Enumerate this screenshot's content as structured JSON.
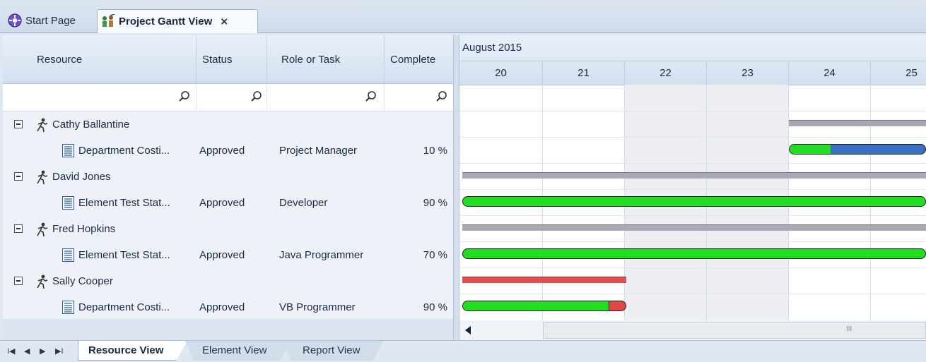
{
  "doc_tabs": {
    "start_label": "Start Page",
    "gantt_label": "Project Gantt View",
    "close_symbol": "×"
  },
  "grid": {
    "headers": {
      "resource": "Resource",
      "status": "Status",
      "role": "Role or Task",
      "complete": "Complete"
    },
    "rows": [
      {
        "type": "group",
        "label": "Cathy Ballantine"
      },
      {
        "type": "task",
        "label": "Department Costi...",
        "status": "Approved",
        "role": "Project Manager",
        "complete": "10 %"
      },
      {
        "type": "group",
        "label": "David Jones"
      },
      {
        "type": "task",
        "label": "Element Test Stat...",
        "status": "Approved",
        "role": "Developer",
        "complete": "90 %"
      },
      {
        "type": "group",
        "label": "Fred Hopkins"
      },
      {
        "type": "task",
        "label": "Element Test Stat...",
        "status": "Approved",
        "role": "Java Programmer",
        "complete": "70 %"
      },
      {
        "type": "group",
        "label": "Sally Cooper"
      },
      {
        "type": "task",
        "label": "Department Costi...",
        "status": "Approved",
        "role": "VB Programmer",
        "complete": "90 %"
      }
    ]
  },
  "gantt": {
    "month": "August 2015",
    "days": [
      "20",
      "21",
      "22",
      "23",
      "24",
      "25"
    ],
    "weekend_days": [
      "22",
      "23"
    ],
    "scroll_thumb_glyph": "III"
  },
  "bottom_tabs": {
    "resource_view": "Resource View",
    "element_view": "Element View",
    "report_view": "Report View",
    "nav_first": "I◀",
    "nav_prev": "◀",
    "nav_next": "▶",
    "nav_last": "▶I"
  },
  "colors": {
    "progress_green": "#22dd22",
    "remaining_blue": "#3b6fc4",
    "overdue_red": "#e04848",
    "summary_gray": "#a9a9b6",
    "summary_red": "#e05050"
  }
}
